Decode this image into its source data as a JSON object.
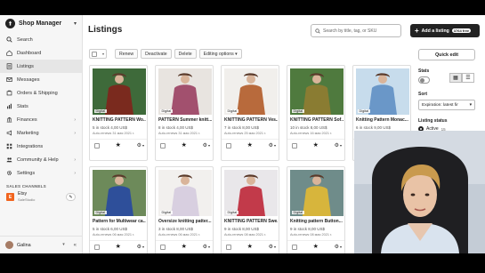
{
  "app": {
    "name": "Shop Manager",
    "logo_letter": ""
  },
  "sidebar": {
    "items": [
      {
        "label": "Search",
        "icon": "search-icon"
      },
      {
        "label": "Dashboard",
        "icon": "home-icon"
      },
      {
        "label": "Listings",
        "icon": "listings-icon",
        "active": true
      },
      {
        "label": "Messages",
        "icon": "mail-icon"
      },
      {
        "label": "Orders & Shipping",
        "icon": "orders-icon"
      },
      {
        "label": "Stats",
        "icon": "stats-icon"
      },
      {
        "label": "Finances",
        "icon": "bank-icon",
        "chevron": true
      },
      {
        "label": "Marketing",
        "icon": "megaphone-icon",
        "chevron": true
      },
      {
        "label": "Integrations",
        "icon": "grid-icon"
      },
      {
        "label": "Community & Help",
        "icon": "people-icon",
        "chevron": true
      },
      {
        "label": "Settings",
        "icon": "gear-icon",
        "chevron": true
      }
    ],
    "sales_channels_title": "SALES CHANNELS",
    "channel": {
      "badge": "E",
      "name": "Etsy",
      "sub": "SaleStudio"
    },
    "user": {
      "name": "Galina"
    }
  },
  "header": {
    "title": "Listings",
    "search_placeholder": "Search by title, tag, or SKU",
    "add_label": "Add a listing",
    "add_count": "3764 free"
  },
  "toolbar": {
    "renew": "Renew",
    "deactivate": "Deactivate",
    "delete": "Delete",
    "editing_options": "Editing options"
  },
  "listings": [
    {
      "title": "KNITTING PATTERN Wo...",
      "meta": "5 in stock    4,00 US$",
      "renew": "Auto-renews 31 мая 2021 г.",
      "tag": "Digital",
      "colors": [
        "#7a2a1e",
        "#3e6a3a"
      ]
    },
    {
      "title": "PATTERN Summer knitt...",
      "meta": "8 in stock    4,00 US$",
      "renew": "Auto-renews 31 мая 2021 г.",
      "tag": "Digital",
      "colors": [
        "#a2506e",
        "#e8e4e0"
      ]
    },
    {
      "title": "KNITTING PATTERN Ves...",
      "meta": "7 in stock    8,00 US$",
      "renew": "Auto-renews 25 мая 2021 г.",
      "tag": "Digital",
      "colors": [
        "#b86a3c",
        "#f1efec"
      ]
    },
    {
      "title": "KNITTING PATTERN Sof...",
      "meta": "10 in stock    8,00 US$",
      "renew": "Auto-renews 16 мая 2021 г.",
      "tag": "Digital",
      "colors": [
        "#8a7c32",
        "#4f7a3e"
      ]
    },
    {
      "title": "Knitting Pattern Monac...",
      "meta": "6 in stock    9,00 US$",
      "renew": "Auto-renews 13 мая 2021 г.",
      "tag": "Digital",
      "colors": [
        "#6a97c8",
        "#c7dcec"
      ]
    },
    {
      "title": "Pattern for Multiwear ca...",
      "meta": "5 in stock    6,00 US$",
      "renew": "Auto-renews 06 мая 2021 г.",
      "tag": "Digital",
      "colors": [
        "#2e4f9a",
        "#6d8a5a"
      ]
    },
    {
      "title": "Oversize knitting patter...",
      "meta": "3 in stock    8,00 US$",
      "renew": "Auto-renews 06 мая 2021 г.",
      "tag": "Digital",
      "colors": [
        "#d8cfe0",
        "#f2f0ee"
      ]
    },
    {
      "title": "KNITTING PATTERN Swe...",
      "meta": "9 in stock    8,00 US$",
      "renew": "Auto-renews 08 мая 2021 г.",
      "tag": "Digital",
      "colors": [
        "#c23a4a",
        "#e9e7ea"
      ]
    },
    {
      "title": "Knitting pattern Button...",
      "meta": "9 in stock    8,00 US$",
      "renew": "Auto-renews 08 мая 2021 г.",
      "tag": "Digital",
      "colors": [
        "#d7b53c",
        "#6f8c8a"
      ]
    }
  ],
  "right_panel": {
    "quick_edit": "Quick edit",
    "stats_label": "Stats",
    "sort_label": "Sort",
    "sort_value": "Expiration: latest fir",
    "status_label": "Listing status",
    "status_active": "Active",
    "status_count": "15"
  }
}
